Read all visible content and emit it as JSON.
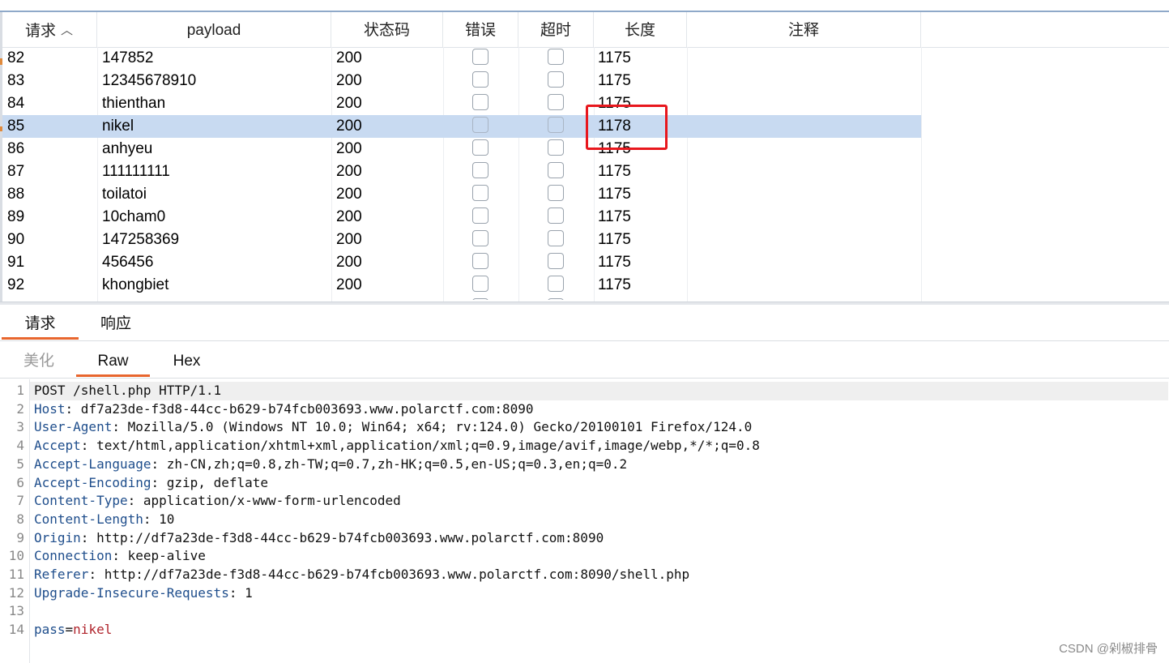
{
  "results_table": {
    "columns": [
      "请求",
      "payload",
      "状态码",
      "错误",
      "超时",
      "长度",
      "注释"
    ],
    "rows": [
      {
        "id": "82",
        "payload": "147852",
        "status": "200",
        "length": "1175"
      },
      {
        "id": "83",
        "payload": "12345678910",
        "status": "200",
        "length": "1175"
      },
      {
        "id": "84",
        "payload": "thienthan",
        "status": "200",
        "length": "1175"
      },
      {
        "id": "85",
        "payload": "nikel",
        "status": "200",
        "length": "1178"
      },
      {
        "id": "86",
        "payload": "anhyeu",
        "status": "200",
        "length": "1175"
      },
      {
        "id": "87",
        "payload": "111111111",
        "status": "200",
        "length": "1175"
      },
      {
        "id": "88",
        "payload": "toilatoi",
        "status": "200",
        "length": "1175"
      },
      {
        "id": "89",
        "payload": "10cham0",
        "status": "200",
        "length": "1175"
      },
      {
        "id": "90",
        "payload": "147258369",
        "status": "200",
        "length": "1175"
      },
      {
        "id": "91",
        "payload": "456456",
        "status": "200",
        "length": "1175"
      },
      {
        "id": "92",
        "payload": "khongbiet",
        "status": "200",
        "length": "1175"
      }
    ],
    "selected_row_id": "85",
    "sort_icon": "chevron-up-icon"
  },
  "message_tabs": [
    "请求",
    "响应"
  ],
  "view_tabs": [
    "美化",
    "Raw",
    "Hex"
  ],
  "request_lines": [
    {
      "key": "POST /shell.php HTTP/1.1",
      "value": ""
    },
    {
      "key": "Host",
      "value": " df7a23de-f3d8-44cc-b629-b74fcb003693.www.polarctf.com:8090"
    },
    {
      "key": "User-Agent",
      "value": " Mozilla/5.0 (Windows NT 10.0; Win64; x64; rv:124.0) Gecko/20100101 Firefox/124.0"
    },
    {
      "key": "Accept",
      "value": " text/html,application/xhtml+xml,application/xml;q=0.9,image/avif,image/webp,*/*;q=0.8"
    },
    {
      "key": "Accept-Language",
      "value": " zh-CN,zh;q=0.8,zh-TW;q=0.7,zh-HK;q=0.5,en-US;q=0.3,en;q=0.2"
    },
    {
      "key": "Accept-Encoding",
      "value": " gzip, deflate"
    },
    {
      "key": "Content-Type",
      "value": " application/x-www-form-urlencoded"
    },
    {
      "key": "Content-Length",
      "value": " 10"
    },
    {
      "key": "Origin",
      "value": " http://df7a23de-f3d8-44cc-b629-b74fcb003693.www.polarctf.com:8090"
    },
    {
      "key": "Connection",
      "value": " keep-alive"
    },
    {
      "key": "Referer",
      "value": " http://df7a23de-f3d8-44cc-b629-b74fcb003693.www.polarctf.com:8090/shell.php"
    },
    {
      "key": "Upgrade-Insecure-Requests",
      "value": " 1"
    },
    {
      "key": "",
      "value": ""
    },
    {
      "key": "pass",
      "value": "nikel"
    }
  ],
  "watermark": "CSDN @剁椒排骨",
  "colors": {
    "accent": "#e8662e",
    "selection": "#c8daf1",
    "highlight": "#e8171d",
    "header_key": "#1f4e8c",
    "body_value": "#b0242c"
  }
}
